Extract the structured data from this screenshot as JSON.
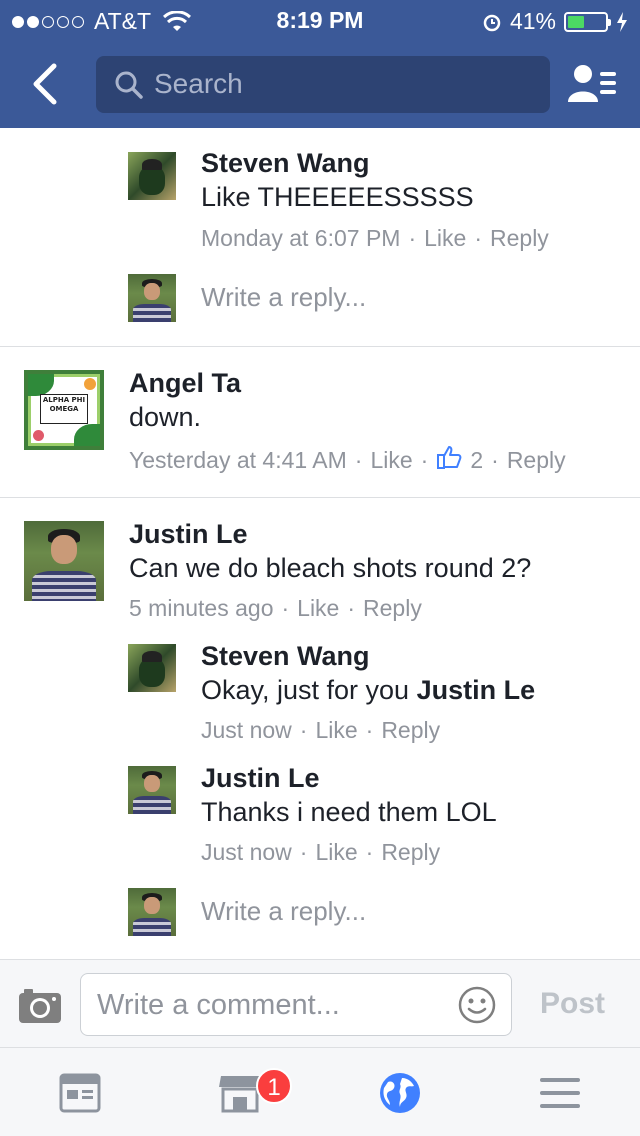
{
  "status_bar": {
    "carrier": "AT&T",
    "time": "8:19 PM",
    "battery_percent": "41%",
    "signal_bars_full": 2,
    "signal_bars_total": 5
  },
  "nav": {
    "search_placeholder": "Search"
  },
  "thread": {
    "steven_reply_1": {
      "name": "Steven Wang",
      "text": "Like THEEEEESSSSS",
      "time": "Monday at 6:07 PM",
      "like": "Like",
      "reply": "Reply"
    },
    "write_reply_1": "Write a reply...",
    "angel_comment": {
      "name": "Angel Ta",
      "text": "down.",
      "time": "Yesterday at 4:41 AM",
      "like": "Like",
      "like_count": "2",
      "reply": "Reply",
      "avatar_text": "ALPHA PHI OMEGA"
    },
    "justin_comment": {
      "name": "Justin Le",
      "text": "Can we do bleach shots round 2?",
      "time": "5 minutes ago",
      "like": "Like",
      "reply": "Reply"
    },
    "steven_reply_2": {
      "name": "Steven Wang",
      "text_prefix": "Okay, just for you ",
      "mention": "Justin Le",
      "time": "Just now",
      "like": "Like",
      "reply": "Reply"
    },
    "justin_reply": {
      "name": "Justin Le",
      "text": "Thanks i need them LOL",
      "time": "Just now",
      "like": "Like",
      "reply": "Reply"
    },
    "write_reply_2": "Write a reply..."
  },
  "composer": {
    "placeholder": "Write a comment...",
    "post_label": "Post"
  },
  "tabbar": {
    "marketplace_badge": "1"
  },
  "colors": {
    "brand": "#3b5998",
    "meta_text": "#90949c",
    "badge": "#fa3e3e",
    "battery": "#4cd964",
    "link_blue": "#4080ff"
  }
}
